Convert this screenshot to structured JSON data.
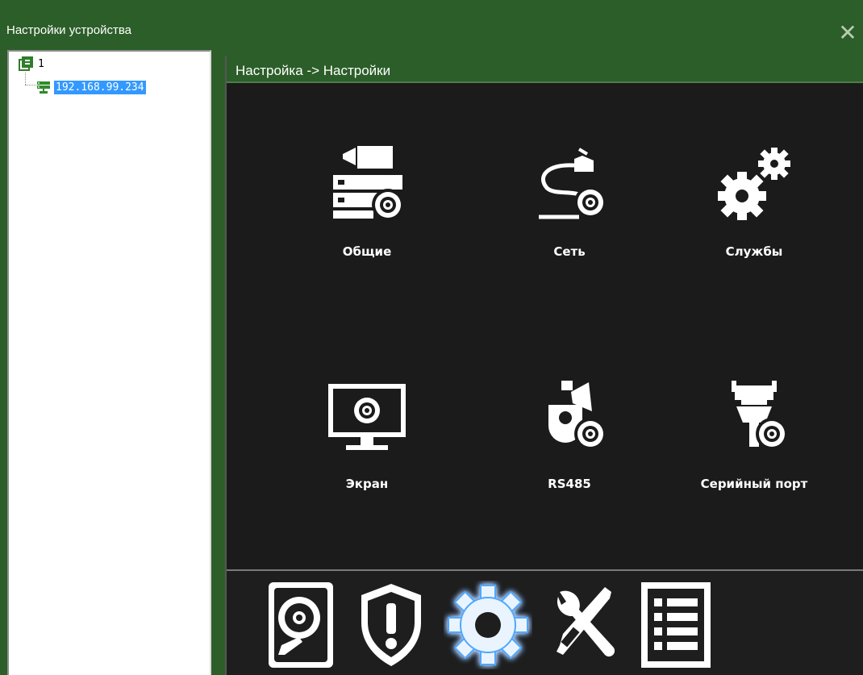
{
  "window": {
    "title": "Настройки устройства",
    "close_glyph": "✕"
  },
  "tree": {
    "root": {
      "label": "1",
      "icon": "device-group-icon"
    },
    "children": [
      {
        "label": "192.168.99.234",
        "icon": "network-device-icon",
        "selected": true
      }
    ]
  },
  "header": {
    "breadcrumb": "Настройка -> Настройки"
  },
  "grid": {
    "items": [
      {
        "label": "Общие",
        "icon": "general-settings-icon"
      },
      {
        "label": "Сеть",
        "icon": "network-cable-icon"
      },
      {
        "label": "Службы",
        "icon": "services-gears-icon"
      },
      {
        "label": "Экран",
        "icon": "monitor-display-icon"
      },
      {
        "label": "RS485",
        "icon": "ptz-camera-icon"
      },
      {
        "label": "Серийный порт",
        "icon": "serial-port-icon"
      }
    ]
  },
  "bottom_bar": {
    "buttons": [
      {
        "name": "storage",
        "icon": "hard-disk-icon"
      },
      {
        "name": "alarm",
        "icon": "alarm-shield-icon"
      },
      {
        "name": "settings",
        "icon": "settings-gear-icon",
        "active": true
      },
      {
        "name": "tools",
        "icon": "tools-icon"
      },
      {
        "name": "info",
        "icon": "info-list-icon"
      }
    ]
  },
  "colors": {
    "titlebar": "#2c5e29",
    "panel_bg": "#1b1b1b",
    "selection": "#3399ff",
    "active_glow": "#4fa8ff"
  }
}
